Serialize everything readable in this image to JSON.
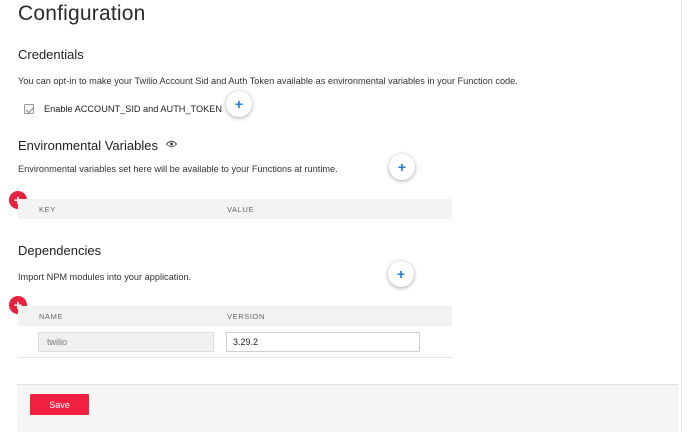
{
  "page": {
    "title": "Configuration"
  },
  "credentials": {
    "title": "Credentials",
    "description": "You can opt-in to make your Twilio Account Sid and Auth Token available as environmental variables in your Function code.",
    "checkbox_label": "Enable ACCOUNT_SID and AUTH_TOKEN",
    "checkbox_checked": true
  },
  "env_vars": {
    "title": "Environmental Variables",
    "description": "Environmental variables set here will be available to your Functions at runtime.",
    "columns": {
      "key": "KEY",
      "value": "VALUE"
    }
  },
  "dependencies": {
    "title": "Dependencies",
    "description": "Import NPM modules into your application.",
    "columns": {
      "name": "NAME",
      "version": "VERSION"
    },
    "rows": [
      {
        "name": "twilio",
        "version": "3.29.2"
      }
    ]
  },
  "footer": {
    "save_label": "Save"
  },
  "icons": {
    "add": "+",
    "eye": "eye-icon"
  },
  "colors": {
    "accent_red": "#f2213f",
    "accent_blue": "#1f7bd6"
  }
}
